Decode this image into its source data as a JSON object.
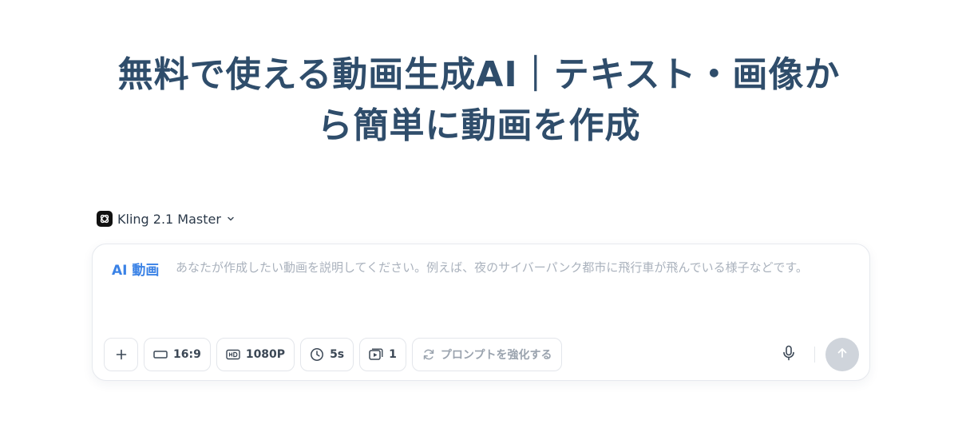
{
  "hero": {
    "title_line1": "無料で使える動画生成AI｜テキスト・画像か",
    "title_line2": "ら簡単に動画を作成"
  },
  "model_selector": {
    "label": "Kling 2.1 Master",
    "icon": "kling-logo-icon"
  },
  "prompt": {
    "mode_label": "AI 動画",
    "value": "",
    "placeholder": "あなたが作成したい動画を説明してください。例えば、夜のサイバーパンク都市に飛行車が飛んでいる様子などです。"
  },
  "toolbar": {
    "add_icon": "plus-icon",
    "aspect_ratio": "16:9",
    "resolution": "1080P",
    "duration": "5s",
    "count": "1",
    "enhance_label": "プロンプトを強化する"
  },
  "colors": {
    "title": "#2f4d6b",
    "accent": "#3a82e6",
    "send_disabled": "#cfd4db"
  }
}
